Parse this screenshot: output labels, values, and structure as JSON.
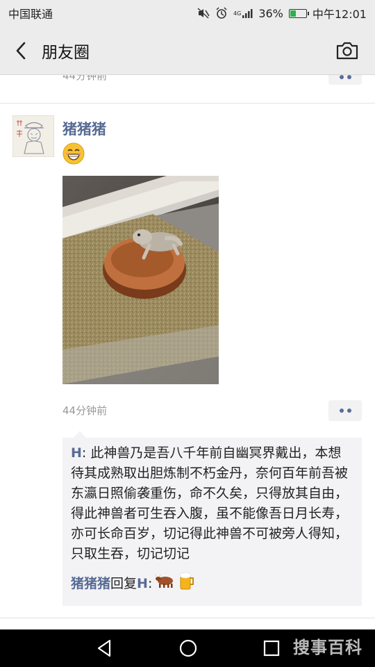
{
  "status_bar": {
    "carrier": "中国联通",
    "network": "4G",
    "battery": "36%",
    "time": "中午12:01"
  },
  "header": {
    "title": "朋友圈"
  },
  "previous_post": {
    "time": "44分钟前"
  },
  "post": {
    "username": "猪猪猪",
    "time": "44分钟前",
    "comments": [
      {
        "author": "H",
        "separator": ": ",
        "text": "此神兽乃是吾八千年前自幽冥界戴出，本想待其成熟取出胆炼制不朽金丹，奈何百年前吾被东瀛日照偷袭重伤，命不久矣，只得放其自由，得此神兽者可生吞入腹，虽不能像吾日月长寿，亦可长命百岁，切记得此神兽不可被旁人得知，只取生吞，切记切记"
      }
    ],
    "reply": {
      "author": "猪猪猪",
      "action": "回复",
      "target": "H",
      "separator": ":"
    }
  },
  "watermark": "搜事百科",
  "colors": {
    "link": "#576b95",
    "bar_bg": "#ececec",
    "comment_bg": "#f3f3f5"
  }
}
